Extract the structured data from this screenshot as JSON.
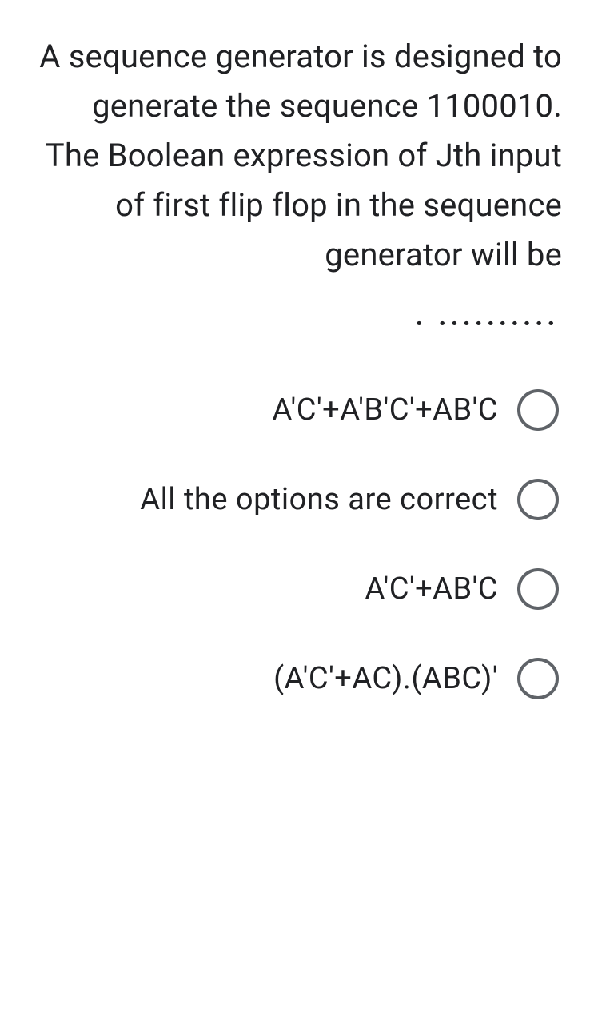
{
  "question": "A sequence generator is designed to generate the sequence 1100010. The Boolean expression of Jth input of first flip flop in the sequence generator will be",
  "blank": ". ..........",
  "options": [
    {
      "label": "A'C'+A'B'C'+AB'C"
    },
    {
      "label": "All the options are correct"
    },
    {
      "label": "A'C'+AB'C"
    },
    {
      "label": "(A'C'+AC).(ABC)'"
    }
  ]
}
